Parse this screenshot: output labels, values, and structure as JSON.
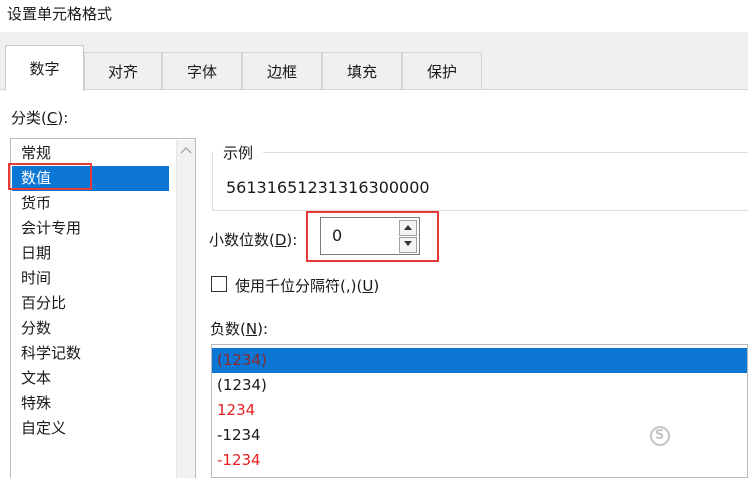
{
  "window": {
    "title": "设置单元格格式"
  },
  "tabs": [
    {
      "label": "数字",
      "active": true
    },
    {
      "label": "对齐",
      "active": false
    },
    {
      "label": "字体",
      "active": false
    },
    {
      "label": "边框",
      "active": false
    },
    {
      "label": "填充",
      "active": false
    },
    {
      "label": "保护",
      "active": false
    }
  ],
  "category": {
    "label_prefix": "分类(",
    "label_key": "C",
    "label_suffix": "):",
    "items": [
      "常规",
      "数值",
      "货币",
      "会计专用",
      "日期",
      "时间",
      "百分比",
      "分数",
      "科学记数",
      "文本",
      "特殊",
      "自定义"
    ],
    "selected": "数值"
  },
  "sample": {
    "label": "示例",
    "value": "56131651231316300000"
  },
  "decimal_places": {
    "label_prefix": "小数位数(",
    "label_key": "D",
    "label_suffix": "):",
    "value": "0"
  },
  "thousands_separator": {
    "checked": false,
    "label_prefix": "使用千位分隔符(,)(",
    "label_key": "U",
    "label_suffix": ")"
  },
  "negative_numbers": {
    "label_prefix": "负数(",
    "label_key": "N",
    "label_suffix": "):",
    "items": [
      {
        "text": "(1234)",
        "color": "#8b2a2a",
        "selected": true
      },
      {
        "text": "(1234)",
        "color": "#1a1a1a",
        "selected": false
      },
      {
        "text": "1234",
        "color": "#e62020",
        "selected": false
      },
      {
        "text": "-1234",
        "color": "#1a1a1a",
        "selected": false
      },
      {
        "text": "-1234",
        "color": "#e62020",
        "selected": false
      }
    ]
  },
  "colors": {
    "selection": "#0b76d4",
    "highlight_box": "#e43a3a"
  },
  "icons": {
    "scroll_up": "chevron-up-icon",
    "spin_up": "triangle-up-icon",
    "spin_down": "triangle-down-icon"
  }
}
